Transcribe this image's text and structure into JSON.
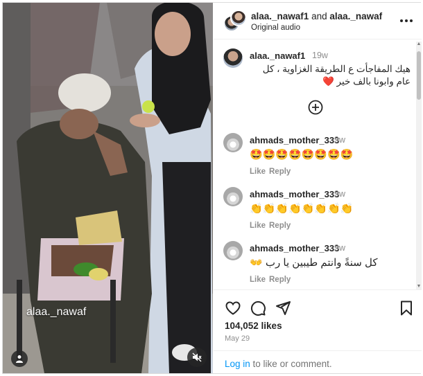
{
  "media": {
    "watermark": "alaa._nawaf",
    "user_tag_icon": "person-icon",
    "mute_icon": "speaker-muted-icon"
  },
  "header": {
    "author1": "alaa._nawaf1",
    "joiner": " and ",
    "author2": "alaa._nawaf",
    "subtitle": "Original audio",
    "more_icon": "more-horizontal-icon"
  },
  "caption": {
    "username": "alaa._nawaf1",
    "time": "19w",
    "text": "هيك المفاجأت ع الطريقة الغزاوية ، كل عام وابونا بالف خير",
    "emoji": "❤️"
  },
  "load_more_icon": "circle-plus-icon",
  "comments": [
    {
      "username": "ahmads_mother_333",
      "time": "9w",
      "text": "🤩🤩🤩🤩🤩🤩🤩🤩",
      "like": "Like",
      "reply": "Reply"
    },
    {
      "username": "ahmads_mother_333",
      "time": "9w",
      "text": "👏👏👏👏👏👏👏👏",
      "like": "Like",
      "reply": "Reply"
    },
    {
      "username": "ahmads_mother_333",
      "time": "9w",
      "text": "كل سنةً وانتم طيبين يا رب 👐",
      "like": "Like",
      "reply": "Reply"
    }
  ],
  "actions": {
    "likes": "104,052 likes",
    "date": "May 29",
    "login_link": "Log in",
    "login_rest": " to like or comment."
  },
  "colors": {
    "link": "#0095f6",
    "muted": "#8e8e8e",
    "text": "#262626"
  }
}
